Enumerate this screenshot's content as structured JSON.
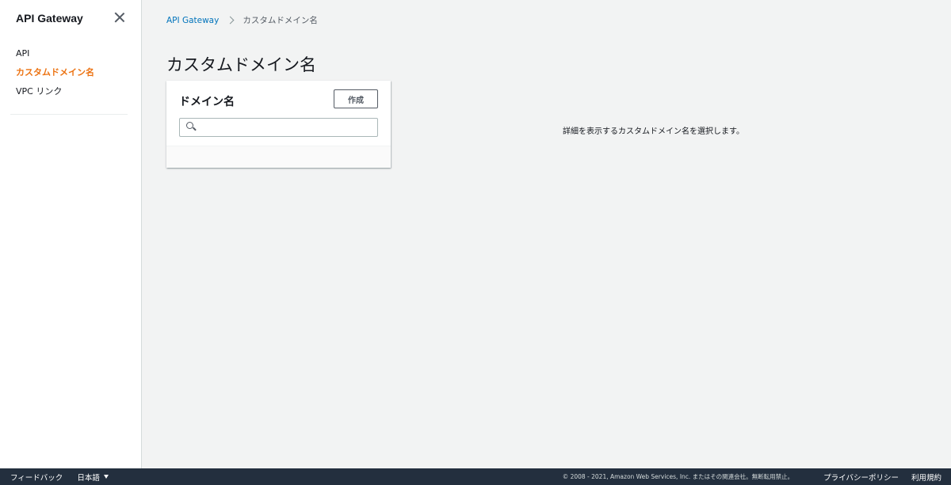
{
  "sidebar": {
    "title": "API Gateway",
    "items": [
      {
        "label": "API"
      },
      {
        "label": "カスタムドメイン名"
      },
      {
        "label": "VPC リンク"
      }
    ]
  },
  "breadcrumb": {
    "root": "API Gateway",
    "current": "カスタムドメイン名"
  },
  "page": {
    "title": "カスタムドメイン名"
  },
  "panel": {
    "title": "ドメイン名",
    "create_label": "作成",
    "search_value": "",
    "search_placeholder": ""
  },
  "detail": {
    "message": "詳細を表示するカスタムドメイン名を選択します。"
  },
  "footer": {
    "feedback": "フィードバック",
    "language": "日本語",
    "copyright": "© 2008 - 2021, Amazon Web Services, Inc. またはその関連会社。無断転用禁止。",
    "privacy": "プライバシーポリシー",
    "terms": "利用規約"
  },
  "colors": {
    "accent": "#ec7211",
    "link": "#0073bb",
    "footer_bg": "#232f3e"
  }
}
